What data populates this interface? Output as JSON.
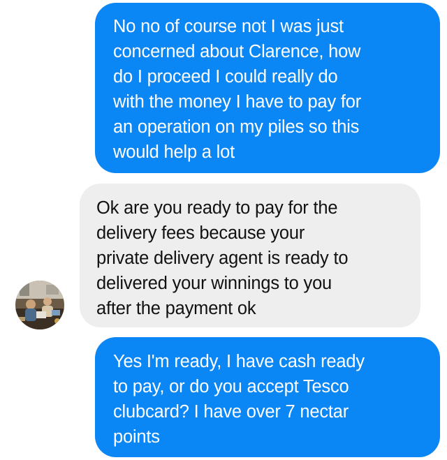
{
  "messages": [
    {
      "sender": "me",
      "text": "No no of course not I was just\nconcerned about Clarence, how\ndo I proceed I could really do\nwith the money I have to pay for\nan operation on my piles so this\nwould help a lot"
    },
    {
      "sender": "other",
      "text": "Ok are you ready to pay for the\ndelivery fees because your\nprivate delivery agent is ready to\ndelivered your winnings to you\nafter the payment ok"
    },
    {
      "sender": "me",
      "text": "Yes I'm ready, I have cash ready\nto pay, or do you accept Tesco\nclubcard? I have over 7 nectar\npoints"
    }
  ],
  "colors": {
    "sent_bubble": "#0b86f5",
    "received_bubble": "#eeeeee"
  },
  "avatar": {
    "icon": "contact-avatar-photo"
  }
}
